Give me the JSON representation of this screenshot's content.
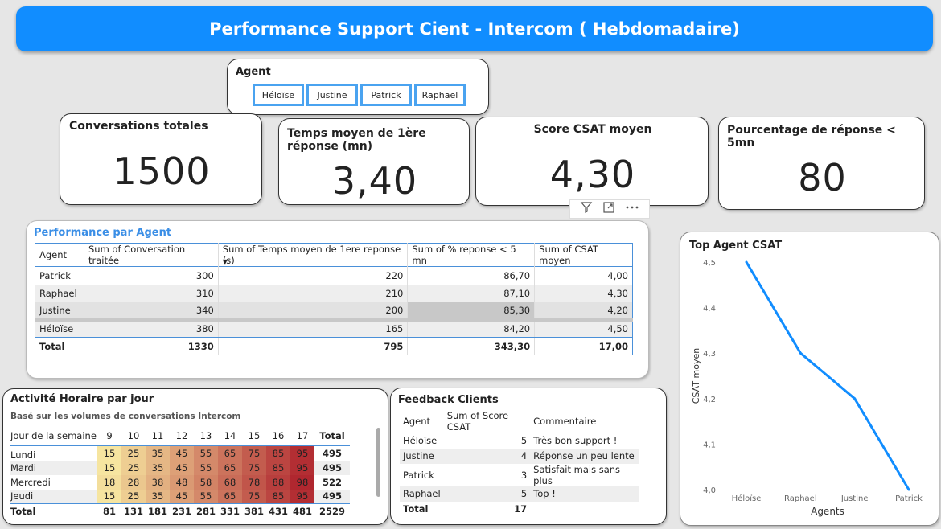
{
  "header": {
    "title": "Performance Support Cient - Intercom ( Hebdomadaire)"
  },
  "slicer": {
    "title": "Agent",
    "options": [
      "Héloïse",
      "Justine",
      "Patrick",
      "Raphael"
    ]
  },
  "kpis": {
    "conversations": {
      "title": "Conversations totales",
      "value": "1500"
    },
    "temps": {
      "title": "Temps moyen de 1ère réponse (mn)",
      "value": "3,40"
    },
    "csat": {
      "title": "Score CSAT moyen",
      "value": "4,30"
    },
    "pourcentage": {
      "title": "Pourcentage de réponse < 5mn",
      "value": "80"
    }
  },
  "perf_table": {
    "title": "Performance par Agent",
    "columns": [
      "Agent",
      "Sum of Conversation traitée",
      "Sum of Temps moyen de 1ere reponse (s)",
      "Sum of % reponse < 5 mn",
      "Sum of CSAT moyen"
    ],
    "rows": [
      [
        "Patrick",
        "300",
        "220",
        "86,70",
        "4,00"
      ],
      [
        "Raphael",
        "310",
        "210",
        "87,10",
        "4,30"
      ],
      [
        "Justine",
        "340",
        "200",
        "85,30",
        "4,20"
      ],
      [
        "Héloïse",
        "380",
        "165",
        "84,20",
        "4,50"
      ]
    ],
    "total": [
      "Total",
      "1330",
      "795",
      "343,30",
      "17,00"
    ]
  },
  "heatmap": {
    "title": "Activité Horaire par jour",
    "subtitle": "Basé sur les volumes de conversations Intercom",
    "corner": "Jour de la semaine",
    "hours": [
      "9",
      "10",
      "11",
      "12",
      "13",
      "14",
      "15",
      "16",
      "17"
    ],
    "total_label": "Total",
    "rows": [
      {
        "day": "Lundi",
        "values": [
          15,
          25,
          35,
          45,
          55,
          65,
          75,
          85,
          95
        ],
        "total": "495"
      },
      {
        "day": "Mardi",
        "values": [
          15,
          25,
          35,
          45,
          55,
          65,
          75,
          85,
          95
        ],
        "total": "495"
      },
      {
        "day": "Mercredi",
        "values": [
          18,
          28,
          38,
          48,
          58,
          68,
          78,
          88,
          98
        ],
        "total": "522"
      },
      {
        "day": "Jeudi",
        "values": [
          15,
          25,
          35,
          45,
          55,
          65,
          75,
          85,
          95
        ],
        "total": "495"
      }
    ],
    "totals_row": {
      "label": "Total",
      "values": [
        81,
        131,
        181,
        231,
        281,
        331,
        381,
        431,
        481
      ],
      "total": "2529"
    },
    "colors": {
      "low": "#f6e5a0",
      "high": "#b0272f"
    }
  },
  "feedback": {
    "title": "Feedback Clients",
    "columns": [
      "Agent",
      "Sum of Score CSAT",
      "Commentaire"
    ],
    "rows": [
      [
        "Héloïse",
        "5",
        "Très bon support !"
      ],
      [
        "Justine",
        "4",
        "Réponse un peu lente"
      ],
      [
        "Patrick",
        "3",
        "Satisfait mais sans plus"
      ],
      [
        "Raphael",
        "5",
        "Top !"
      ]
    ],
    "total": [
      "Total",
      "17",
      ""
    ]
  },
  "chart_data": {
    "type": "line",
    "title": "Top Agent CSAT",
    "categories": [
      "Héloïse",
      "Raphael",
      "Justine",
      "Patrick"
    ],
    "values": [
      4.5,
      4.3,
      4.2,
      4.0
    ],
    "xlabel": "Agents",
    "ylabel": "CSAT moyen",
    "ylim": [
      4.0,
      4.5
    ],
    "yticks": [
      "4,0",
      "4,1",
      "4,2",
      "4,3",
      "4,4",
      "4,5"
    ],
    "color": "#118dff",
    "grid": false
  },
  "visual_header_icons": [
    "filter-icon",
    "focus-mode-icon",
    "more-options-icon"
  ]
}
